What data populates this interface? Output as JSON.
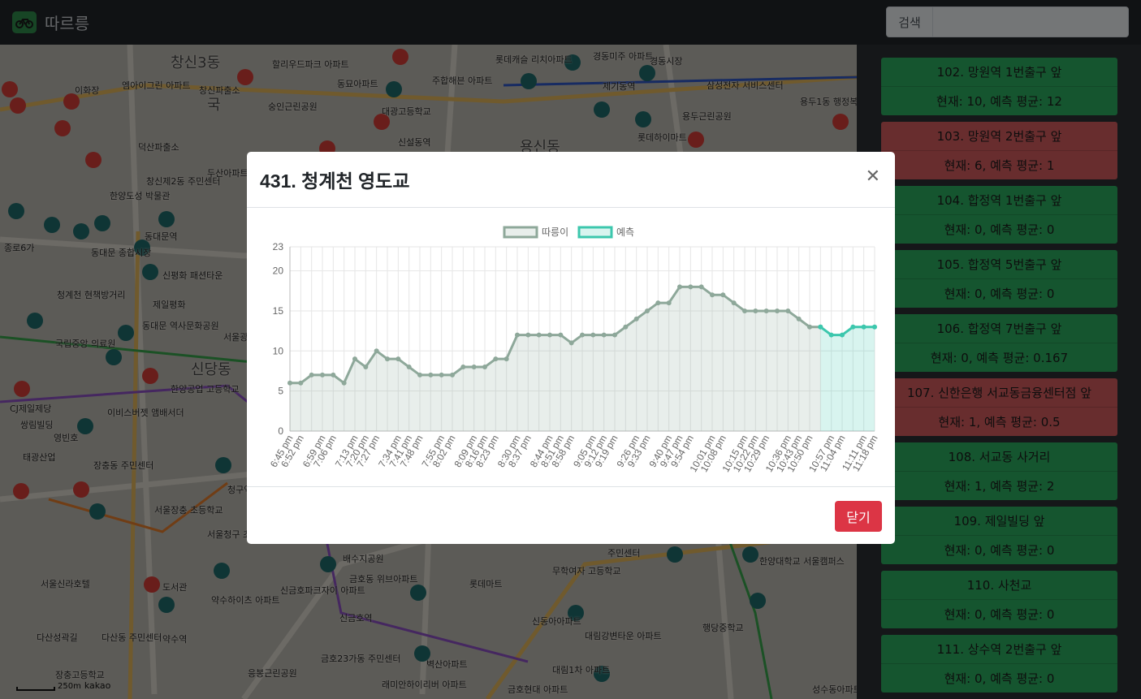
{
  "app": {
    "title": "따르릉"
  },
  "search": {
    "label": "검색",
    "placeholder": "",
    "value": ""
  },
  "map": {
    "labels": [
      "창신3동",
      "창신파출소",
      "할리우드파크 아파트",
      "동묘아파트",
      "숭인근린공원",
      "주합해븐 아파트",
      "대광고등학교",
      "롯데캐슬 리치아파트",
      "경동미주 아파트",
      "경동시장",
      "제기동역",
      "삼성전자 서비스센터",
      "용두1동 행정복지센터",
      "이화장",
      "엠아이그린 아파트",
      "덕산파출소",
      "창신제2동 주민센터",
      "두산아파트",
      "용신동",
      "한양도성 박물관",
      "종로6가",
      "동대문역",
      "동대문 종합시장",
      "청계천 현책방거리",
      "신평화 패션타운",
      "제일평화",
      "국립중앙 의료원",
      "동대문 역사문화공원",
      "서울광희 초등학교",
      "한양공업 고등학교",
      "CJ제일제당",
      "쌍림빌딩",
      "이비스버젯 앰배서더",
      "태광산업",
      "영빈호",
      "장충동 주민센터",
      "청구역",
      "서울장충 초등학교",
      "서울청구 초등학교",
      "신당동",
      "배수지공원",
      "신금호파크자이 아파트",
      "금호동 위브아파트",
      "롯데마트",
      "무학여자 고등학교",
      "주민센터",
      "한양대학교 서울캠퍼스",
      "행당중학교",
      "신금호역",
      "금호23가동 주민센터",
      "벽산아파트",
      "대림강변타운 아파트",
      "신동아아파트",
      "응봉근린공원",
      "래미안하이리버 아파트",
      "금호현대 아파트",
      "대림1차 아파트",
      "성수동아파트",
      "서울신라호텔",
      "다산성곽길",
      "다산동 주민센터",
      "장충고등학교",
      "도서관",
      "약수역",
      "약수하이츠 아파트",
      "신설동역",
      "롯데하이마트",
      "용두근린공원",
      "국"
    ],
    "scale": "250m",
    "attribution": "kakao"
  },
  "modal": {
    "title": "431. 청계천 영도교",
    "close_label": "닫기"
  },
  "stations": [
    {
      "title": "102. 망원역 1번출구 앞",
      "stat": "현재: 10, 예측 평균: 12",
      "status": "green"
    },
    {
      "title": "103. 망원역 2번출구 앞",
      "stat": "현재: 6, 예측 평균: 1",
      "status": "red"
    },
    {
      "title": "104. 합정역 1번출구 앞",
      "stat": "현재: 0, 예측 평균: 0",
      "status": "green"
    },
    {
      "title": "105. 합정역 5번출구 앞",
      "stat": "현재: 0, 예측 평균: 0",
      "status": "green"
    },
    {
      "title": "106. 합정역 7번출구 앞",
      "stat": "현재: 0, 예측 평균: 0.167",
      "status": "green"
    },
    {
      "title": "107. 신한은행 서교동금융센터점 앞",
      "stat": "현재: 1, 예측 평균: 0.5",
      "status": "red"
    },
    {
      "title": "108. 서교동 사거리",
      "stat": "현재: 1, 예측 평균: 2",
      "status": "green"
    },
    {
      "title": "109. 제일빌딩 앞",
      "stat": "현재: 0, 예측 평균: 0",
      "status": "green"
    },
    {
      "title": "110. 사천교",
      "stat": "현재: 0, 예측 평균: 0",
      "status": "green"
    },
    {
      "title": "111. 상수역 2번출구 앞",
      "stat": "현재: 0, 예측 평균: 0",
      "status": "green"
    }
  ],
  "colors": {
    "green": "#2bab5e",
    "red": "#d15a5d",
    "series_actual": "#8ea89a",
    "series_pred": "#3cc7ad",
    "danger": "#dc3545"
  },
  "chart_data": {
    "type": "line",
    "title": "",
    "xlabel": "",
    "ylabel": "",
    "ylim": [
      0,
      23
    ],
    "yticks": [
      0,
      5,
      10,
      15,
      20,
      23
    ],
    "legend_position": "top",
    "x": [
      "6:45 pm",
      "6:52 pm",
      "6:59 pm",
      "7:06 pm",
      "7:13 pm",
      "7:20 pm",
      "7:27 pm",
      "7:34 pm",
      "7:41 pm",
      "7:48 pm",
      "7:55 pm",
      "8:02 pm",
      "8:09 pm",
      "8:16 pm",
      "8:23 pm",
      "8:30 pm",
      "8:37 pm",
      "8:44 pm",
      "8:51 pm",
      "8:58 pm",
      "9:05 pm",
      "9:12 pm",
      "9:19 pm",
      "9:26 pm",
      "9:33 pm",
      "9:40 pm",
      "9:47 pm",
      "9:54 pm",
      "10:01 pm",
      "10:08 pm",
      "10:15 pm",
      "10:22 pm",
      "10:29 pm",
      "10:36 pm",
      "10:43 pm",
      "10:50 pm",
      "10:57 pm",
      "11:04 pm",
      "11:11 pm",
      "11:18 pm"
    ],
    "categories_count": 55,
    "series": [
      {
        "name": "따릉이",
        "start_index": 0,
        "values": [
          6,
          6,
          7,
          7,
          7,
          6,
          9,
          8,
          10,
          9,
          9,
          8,
          7,
          7,
          7,
          7,
          8,
          8,
          8,
          9,
          9,
          12,
          12,
          12,
          12,
          12,
          11,
          12,
          12,
          12,
          12,
          13,
          14,
          15,
          16,
          16,
          18,
          18,
          18,
          17,
          17,
          16,
          15,
          15,
          15,
          15,
          15,
          14,
          13,
          13
        ]
      },
      {
        "name": "예측",
        "start_index": 49,
        "values": [
          13,
          12,
          12,
          13,
          13,
          13
        ]
      }
    ]
  }
}
